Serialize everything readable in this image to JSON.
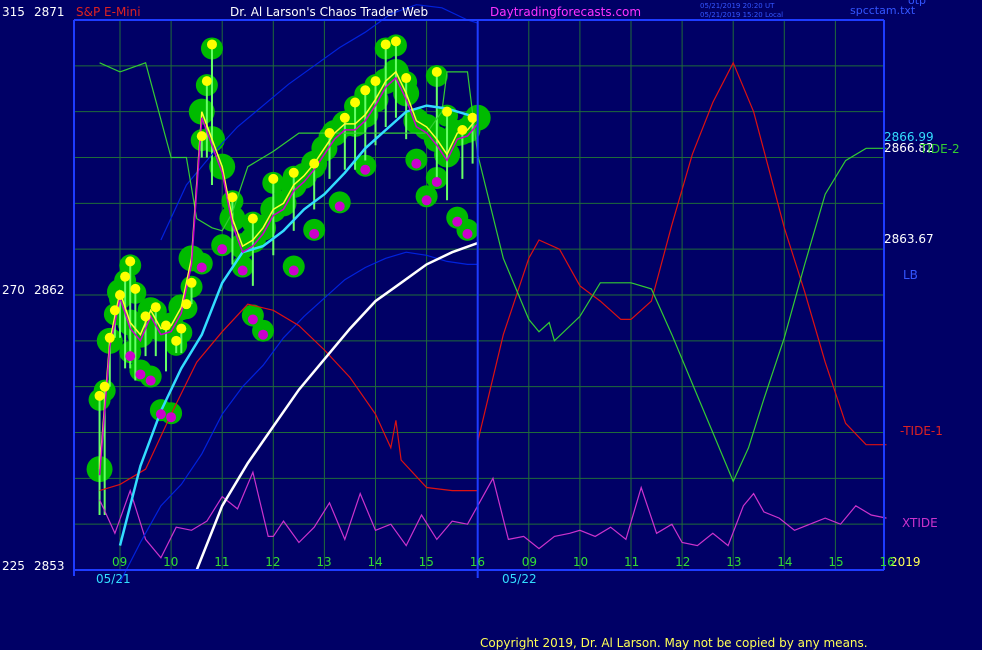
{
  "header": {
    "instrument": "S&P E-Mini",
    "title": "Dr. Al Larson's Chaos Trader Web",
    "site": "Daytradingforecasts.com",
    "timestamp_ut": "05/21/2019 20:20 UT",
    "timestamp_local": "05/21/2019 15:20 Local",
    "file_tag": "otp",
    "file_name": "spcctam.txt"
  },
  "left_axis": {
    "top": {
      "osc": "315",
      "price": "2871"
    },
    "mid": {
      "osc": "270",
      "price": "2862"
    },
    "bottom": {
      "osc": "225",
      "price": "2853"
    }
  },
  "right_labels": {
    "price_1": "2866.99",
    "price_2": "2866.82",
    "price_3": "2863.67",
    "tide2": "TIDE-2",
    "lb": "LB",
    "tide1": "-TIDE-1",
    "xtide": "XTIDE",
    "year": "2019"
  },
  "footer": {
    "copyright": "Copyright 2019, Dr. Al Larson. May not be copied by any means."
  },
  "colors": {
    "background": "#000066",
    "grid": "#1f6b3a",
    "axis": "#1e3cff",
    "price_line": "#ffff33",
    "green_band": "#00bb00",
    "magenta": "#cc00cc",
    "cyan": "#33ddff",
    "white": "#ffffff",
    "blue": "#0022dd",
    "red": "#dd1111",
    "lime": "#33cc33",
    "xtide": "#cc33cc"
  },
  "chart_data": {
    "type": "line",
    "ylim": [
      2853,
      2871
    ],
    "x_ticks_day1": [
      "09",
      "10",
      "11",
      "12",
      "13",
      "14",
      "15",
      "16"
    ],
    "x_ticks_day2": [
      "09",
      "10",
      "11",
      "12",
      "13",
      "14",
      "15",
      "16"
    ],
    "dates": [
      "05/21",
      "05/22"
    ],
    "x_hours": [
      8.5,
      9,
      10,
      11,
      12,
      13,
      14,
      15,
      16
    ],
    "x_hours_day2": [
      16,
      17,
      18,
      19,
      20,
      21,
      22,
      23,
      24
    ],
    "series": [
      {
        "key": "price",
        "x": [
          8.6,
          8.8,
          9.0,
          9.2,
          9.4,
          9.6,
          9.8,
          10.0,
          10.2,
          10.4,
          10.6,
          10.8,
          11.0,
          11.2,
          11.4,
          11.6,
          11.8,
          12.0,
          12.2,
          12.4,
          12.6,
          12.8,
          13.0,
          13.2,
          13.4,
          13.6,
          13.8,
          14.0,
          14.2,
          14.4,
          14.6,
          14.8,
          15.0,
          15.2,
          15.4,
          15.6,
          15.8,
          16.0
        ],
        "y": [
          2856.3,
          2860.5,
          2862.1,
          2861.1,
          2860.7,
          2861.5,
          2860.9,
          2861.0,
          2861.6,
          2863.2,
          2868.0,
          2867.1,
          2866.2,
          2864.5,
          2863.6,
          2863.8,
          2864.2,
          2864.8,
          2865.0,
          2865.6,
          2865.9,
          2866.3,
          2866.8,
          2867.3,
          2867.6,
          2867.6,
          2867.9,
          2868.4,
          2869.0,
          2869.3,
          2868.6,
          2867.7,
          2867.5,
          2867.1,
          2866.6,
          2867.3,
          2867.4,
          2867.8
        ]
      },
      {
        "key": "cyan",
        "x": [
          9.0,
          9.4,
          9.8,
          10.2,
          10.6,
          11.0,
          11.4,
          11.8,
          12.2,
          12.6,
          13.0,
          13.4,
          13.8,
          14.2,
          14.6,
          15.0,
          15.4,
          15.8,
          16.0
        ],
        "y": [
          2853.8,
          2856.4,
          2858.2,
          2859.6,
          2860.7,
          2862.4,
          2863.4,
          2863.6,
          2864.1,
          2864.8,
          2865.3,
          2866.0,
          2866.8,
          2867.4,
          2868.0,
          2868.2,
          2868.1,
          2867.9,
          2867.8
        ]
      },
      {
        "key": "white",
        "x": [
          10.5,
          11.0,
          11.5,
          12.0,
          12.5,
          13.0,
          13.5,
          14.0,
          14.5,
          15.0,
          15.5,
          16.0
        ],
        "y": [
          2853.0,
          2855.1,
          2856.5,
          2857.7,
          2858.9,
          2859.9,
          2860.9,
          2861.8,
          2862.4,
          2863.0,
          2863.4,
          2863.7
        ]
      },
      {
        "key": "blue_upper",
        "x": [
          9.8,
          10.3,
          10.8,
          11.3,
          11.8,
          12.3,
          12.8,
          13.3,
          13.8,
          14.3,
          14.8,
          15.3,
          15.8,
          16.0
        ],
        "y": [
          2863.8,
          2865.6,
          2866.6,
          2867.5,
          2868.2,
          2868.9,
          2869.5,
          2870.1,
          2870.6,
          2871.2,
          2871.5,
          2871.4,
          2871.0,
          2870.9
        ]
      },
      {
        "key": "blue_lower",
        "x": [
          9.0,
          9.4,
          9.8,
          10.2,
          10.6,
          11.0,
          11.4,
          11.8,
          12.2,
          12.6,
          13.0,
          13.4,
          13.8,
          14.2,
          14.6,
          15.0,
          15.4,
          15.8,
          16.0
        ],
        "y": [
          2852.6,
          2853.9,
          2855.1,
          2855.8,
          2856.8,
          2858.1,
          2859.0,
          2859.7,
          2860.6,
          2861.3,
          2861.9,
          2862.5,
          2862.9,
          2863.2,
          2863.4,
          2863.3,
          2863.1,
          2863.0,
          2863.0
        ]
      },
      {
        "key": "red",
        "x": [
          8.6,
          9.0,
          9.5,
          10.0,
          10.5,
          11.0,
          11.5,
          12.0,
          12.5,
          13.0,
          13.5,
          14.0,
          14.3,
          14.4,
          14.5,
          15.0,
          15.5,
          16.0,
          16.0,
          16.5,
          17.0,
          17.2,
          17.6,
          18.0,
          18.4,
          18.8,
          19.0,
          19.4,
          19.8,
          20.2,
          20.6,
          21.0,
          21.4,
          21.7,
          22.0,
          22.4,
          22.8,
          23.2,
          23.6,
          24.0
        ],
        "y": [
          2855.6,
          2855.8,
          2856.3,
          2858.1,
          2859.8,
          2860.8,
          2861.7,
          2861.5,
          2861.0,
          2860.2,
          2859.3,
          2858.1,
          2857.0,
          2857.9,
          2856.6,
          2855.7,
          2855.6,
          2855.6,
          2857.2,
          2860.7,
          2863.2,
          2863.8,
          2863.5,
          2862.3,
          2861.8,
          2861.2,
          2861.2,
          2861.8,
          2864.3,
          2866.6,
          2868.3,
          2869.6,
          2868.0,
          2866.1,
          2864.2,
          2862.1,
          2859.8,
          2857.8,
          2857.1,
          2857.1
        ]
      },
      {
        "key": "lime",
        "x": [
          8.6,
          9.0,
          9.5,
          10.0,
          10.3,
          10.5,
          10.8,
          11.0,
          11.2,
          11.5,
          12.0,
          12.5,
          13.0,
          13.5,
          14.0,
          14.5,
          15.0,
          15.3,
          15.4,
          15.8,
          16.0,
          16.5,
          17.0,
          17.2,
          17.4,
          17.5,
          18.0,
          18.4,
          19.0,
          19.4,
          19.8,
          20.2,
          20.6,
          21.0,
          21.3,
          21.6,
          22.0,
          22.4,
          22.8,
          23.2,
          23.6,
          24.0
        ],
        "y": [
          2869.6,
          2869.3,
          2869.6,
          2866.5,
          2866.5,
          2864.5,
          2864.2,
          2864.1,
          2864.7,
          2866.2,
          2866.7,
          2867.3,
          2867.3,
          2867.3,
          2867.3,
          2867.3,
          2867.3,
          2868.0,
          2869.3,
          2869.3,
          2866.6,
          2863.2,
          2861.2,
          2860.8,
          2861.1,
          2860.5,
          2861.3,
          2862.4,
          2862.4,
          2862.2,
          2860.7,
          2859.1,
          2857.5,
          2855.9,
          2857.0,
          2858.6,
          2860.6,
          2863.0,
          2865.3,
          2866.4,
          2866.8,
          2866.8
        ]
      },
      {
        "key": "xtide",
        "x": [
          8.6,
          8.9,
          9.2,
          9.5,
          9.8,
          10.1,
          10.4,
          10.7,
          11.0,
          11.3,
          11.6,
          11.9,
          12.0,
          12.2,
          12.5,
          12.8,
          13.1,
          13.4,
          13.7,
          14.0,
          14.3,
          14.6,
          14.9,
          15.2,
          15.5,
          15.8,
          16.0,
          16.3,
          16.6,
          16.9,
          17.2,
          17.5,
          17.8,
          18.0,
          18.3,
          18.6,
          18.9,
          19.2,
          19.5,
          19.8,
          20.0,
          20.3,
          20.6,
          20.9,
          21.2,
          21.4,
          21.6,
          21.9,
          22.2,
          22.5,
          22.8,
          23.1,
          23.4,
          23.7,
          24.0
        ],
        "y": [
          2855.3,
          2854.2,
          2855.6,
          2854.0,
          2853.4,
          2854.4,
          2854.3,
          2854.6,
          2855.4,
          2855.0,
          2856.2,
          2854.1,
          2854.1,
          2854.6,
          2853.9,
          2854.4,
          2855.2,
          2854.0,
          2855.5,
          2854.3,
          2854.5,
          2853.8,
          2854.8,
          2854.0,
          2854.6,
          2854.5,
          2855.1,
          2856.0,
          2854.0,
          2854.1,
          2853.7,
          2854.1,
          2854.2,
          2854.3,
          2854.1,
          2854.4,
          2854.0,
          2855.7,
          2854.2,
          2854.5,
          2853.9,
          2853.8,
          2854.2,
          2853.8,
          2855.1,
          2855.5,
          2854.9,
          2854.7,
          2854.3,
          2854.5,
          2854.7,
          2854.5,
          2855.1,
          2854.8,
          2854.7
        ]
      }
    ],
    "highs": [
      {
        "x": 8.6,
        "y": 2858.7
      },
      {
        "x": 8.7,
        "y": 2859.0
      },
      {
        "x": 8.8,
        "y": 2860.6
      },
      {
        "x": 8.9,
        "y": 2861.5
      },
      {
        "x": 9.0,
        "y": 2862.0
      },
      {
        "x": 9.1,
        "y": 2862.6
      },
      {
        "x": 9.2,
        "y": 2863.1
      },
      {
        "x": 9.3,
        "y": 2862.2
      },
      {
        "x": 9.5,
        "y": 2861.3
      },
      {
        "x": 9.7,
        "y": 2861.6
      },
      {
        "x": 9.9,
        "y": 2861.0
      },
      {
        "x": 10.1,
        "y": 2860.5
      },
      {
        "x": 10.2,
        "y": 2860.9
      },
      {
        "x": 10.3,
        "y": 2861.7
      },
      {
        "x": 10.4,
        "y": 2862.4
      },
      {
        "x": 10.6,
        "y": 2867.2
      },
      {
        "x": 10.7,
        "y": 2869.0
      },
      {
        "x": 10.8,
        "y": 2870.2
      },
      {
        "x": 11.2,
        "y": 2865.2
      },
      {
        "x": 11.6,
        "y": 2864.5
      },
      {
        "x": 12.0,
        "y": 2865.8
      },
      {
        "x": 12.4,
        "y": 2866.0
      },
      {
        "x": 12.8,
        "y": 2866.3
      },
      {
        "x": 13.1,
        "y": 2867.3
      },
      {
        "x": 13.4,
        "y": 2867.8
      },
      {
        "x": 13.6,
        "y": 2868.3
      },
      {
        "x": 13.8,
        "y": 2868.7
      },
      {
        "x": 14.0,
        "y": 2869.0
      },
      {
        "x": 14.2,
        "y": 2870.2
      },
      {
        "x": 14.4,
        "y": 2870.3
      },
      {
        "x": 14.6,
        "y": 2869.1
      },
      {
        "x": 15.2,
        "y": 2869.3
      },
      {
        "x": 15.4,
        "y": 2868.0
      },
      {
        "x": 15.7,
        "y": 2867.4
      },
      {
        "x": 15.9,
        "y": 2867.8
      }
    ],
    "lows": [
      {
        "x": 9.2,
        "y": 2860.0
      },
      {
        "x": 9.4,
        "y": 2859.4
      },
      {
        "x": 9.6,
        "y": 2859.2
      },
      {
        "x": 9.8,
        "y": 2858.1
      },
      {
        "x": 10.0,
        "y": 2858.0
      },
      {
        "x": 10.6,
        "y": 2862.9
      },
      {
        "x": 11.0,
        "y": 2863.5
      },
      {
        "x": 11.4,
        "y": 2862.8
      },
      {
        "x": 11.6,
        "y": 2861.2
      },
      {
        "x": 11.8,
        "y": 2860.7
      },
      {
        "x": 12.4,
        "y": 2862.8
      },
      {
        "x": 12.8,
        "y": 2864.0
      },
      {
        "x": 13.3,
        "y": 2864.9
      },
      {
        "x": 13.8,
        "y": 2866.1
      },
      {
        "x": 14.8,
        "y": 2866.3
      },
      {
        "x": 15.0,
        "y": 2865.1
      },
      {
        "x": 15.2,
        "y": 2865.7
      },
      {
        "x": 15.6,
        "y": 2864.4
      },
      {
        "x": 15.8,
        "y": 2864.0
      }
    ]
  }
}
